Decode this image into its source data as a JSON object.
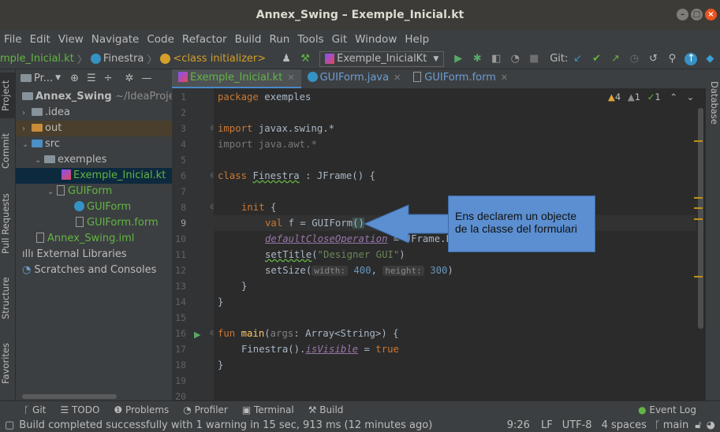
{
  "window": {
    "title": "Annex_Swing – Exemple_Inicial.kt"
  },
  "menu": [
    "File",
    "Edit",
    "View",
    "Navigate",
    "Code",
    "Refactor",
    "Build",
    "Run",
    "Tools",
    "Git",
    "Window",
    "Help"
  ],
  "breadcrumb": {
    "file": "mple_Inicial.kt",
    "class": "Finestra",
    "member": "<class initializer>"
  },
  "run_config": "Exemple_InicialKt",
  "git_label": "Git:",
  "left_tabs": [
    "Project",
    "Commit",
    "Pull Requests",
    "Structure",
    "Favorites"
  ],
  "right_tabs": [
    "Database"
  ],
  "project_panel": {
    "title": "Pr..."
  },
  "tree": [
    {
      "label": "Annex_Swing",
      "extra": "~/IdeaProjec"
    },
    {
      "label": ".idea"
    },
    {
      "label": "out"
    },
    {
      "label": "src"
    },
    {
      "label": "exemples"
    },
    {
      "label": "Exemple_Inicial.kt"
    },
    {
      "label": "GUIForm"
    },
    {
      "label": "GUIForm"
    },
    {
      "label": "GUIForm.form"
    },
    {
      "label": "Annex_Swing.iml"
    },
    {
      "label": "External Libraries"
    },
    {
      "label": "Scratches and Consoles"
    }
  ],
  "tabs": [
    "Exemple_Inicial.kt",
    "GUIForm.java",
    "GUIForm.form"
  ],
  "inspections": {
    "warnings": "4",
    "weak": "1",
    "typos": "1"
  },
  "line_numbers": [
    "1",
    "2",
    "3",
    "4",
    "5",
    "6",
    "7",
    "8",
    "9",
    "10",
    "11",
    "12",
    "13",
    "14",
    "15",
    "16",
    "17",
    "18",
    "19",
    "20"
  ],
  "code": {
    "l1_kw": "package",
    "l1_rest": " exemples",
    "l3_kw": "import",
    "l3_rest": " javax.swing.*",
    "l4_kw": "import",
    "l4_rest": " java.awt.*",
    "l6_kw": "class",
    "l6_name": "Finestra",
    "l6_rest": " : JFrame() {",
    "l8_kw": "init",
    "l8_rest": " {",
    "l9_kw": "val",
    "l9_mid": " f = GUIForm",
    "l9_paren": "()",
    "l10_prop": "defaultCloseOperation",
    "l10_rest": " = JFrame.E",
    "l11_fn": "setTitle",
    "l11_a": "(",
    "l11_str": "\"Designer GUI\"",
    "l11_b": ")",
    "l12_fn": "setSize",
    "l12_a": "(",
    "l12_hint1": "width:",
    "l12_n1": "400",
    "l12_c": ", ",
    "l12_hint2": "height:",
    "l12_n2": "300",
    "l12_b": ")",
    "l13": "}",
    "l14": "}",
    "l16_kw": "fun",
    "l16_fn": "main",
    "l16_a": "(",
    "l16_arg": "args",
    "l16_b": ": Array<String>) {",
    "l17_a": "Finestra().",
    "l17_prop": "isVisible",
    "l17_b": " = ",
    "l17_kw": "true",
    "l18": "}"
  },
  "callout": {
    "line1": "Ens declarem un objecte",
    "line2": "de la classe del formulari"
  },
  "bottom_tools": [
    "Git",
    "TODO",
    "Problems",
    "Profiler",
    "Terminal",
    "Build"
  ],
  "event_log": "Event Log",
  "status": {
    "message": "Build completed successfully with 1 warning in 15 sec, 913 ms (12 minutes ago)",
    "position": "9:26",
    "line_sep": "LF",
    "encoding": "UTF-8",
    "indent": "4 spaces",
    "branch": "main"
  }
}
